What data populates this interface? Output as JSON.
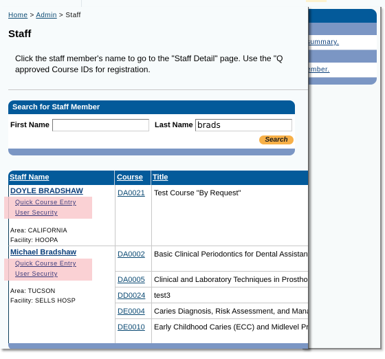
{
  "background_window": {
    "row1_link": "summary.",
    "row2_link": "ember."
  },
  "breadcrumb": {
    "items": [
      {
        "label": "Home",
        "link": true
      },
      {
        "label": "Admin",
        "link": true
      },
      {
        "label": "Staff",
        "link": false
      }
    ],
    "separator": ">"
  },
  "page_title": "Staff",
  "intro": {
    "line1": "Click the staff member's name to go to the \"Staff Detail\" page. Use the \"Q",
    "line2": "approved Course IDs for registration."
  },
  "search": {
    "title": "Search for Staff Member",
    "first_name_label": "First Name",
    "first_name_value": "",
    "last_name_label": "Last Name",
    "last_name_value": "brads",
    "button_label": "Search",
    "button_color": "#f7b048"
  },
  "results": {
    "columns": [
      "Staff Name",
      "Course",
      "Title"
    ],
    "staff": [
      {
        "name": "DOYLE BRADSHAW",
        "links": [
          "Quick Course Entry",
          "User Security"
        ],
        "area": "Area: CALIFORNIA",
        "facility": "Facility: HOOPA",
        "courses": [
          {
            "code": "DA0021",
            "title": "Test Course \"By Request\""
          }
        ]
      },
      {
        "name": "Michael Bradshaw",
        "links": [
          "Quick Course Entry",
          "User Security"
        ],
        "area": "Area: TUCSON",
        "facility": "Facility: SELLS HOSP",
        "courses": [
          {
            "code": "DA0002",
            "title": "Basic Clinical Periodontics for Dental Assistant"
          },
          {
            "code": "DA0005",
            "title": "Clinical and Laboratory Techniques in Prosthoc"
          },
          {
            "code": "DD0024",
            "title": "test3"
          },
          {
            "code": "DE0004",
            "title": "Caries Diagnosis, Risk Assessment, and Mana"
          },
          {
            "code": "DE0010",
            "title": "Early Childhood Caries (ECC) and Midlevel Prov"
          }
        ]
      }
    ]
  },
  "colors": {
    "header_blue": "#035a9a",
    "footer_blue": "#7b96c4",
    "highlight": "#f9c9cc",
    "link": "#0b4a73"
  }
}
